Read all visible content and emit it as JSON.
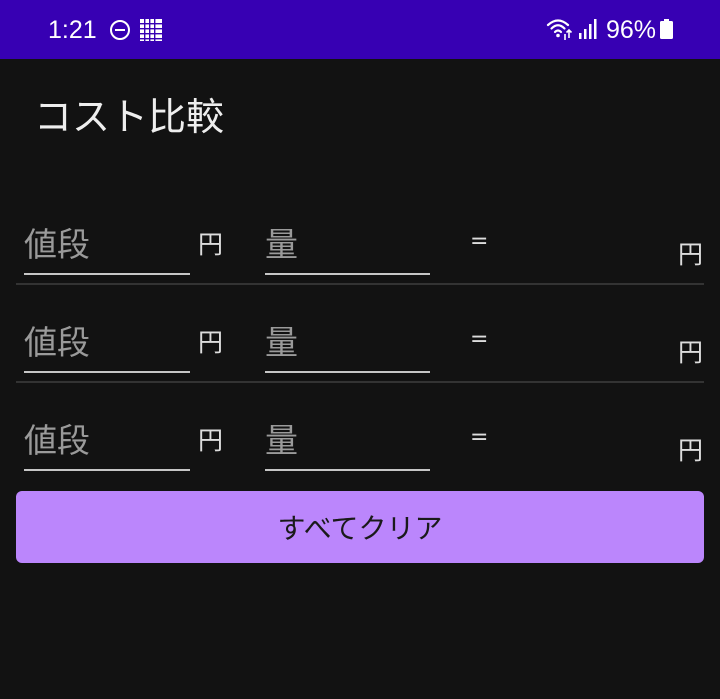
{
  "status_bar": {
    "time": "1:21",
    "battery": "96%",
    "background": "#3700b3"
  },
  "app": {
    "title": "コスト比較",
    "background": "#121212"
  },
  "rows": [
    {
      "price_placeholder": "値段",
      "price_value": "",
      "price_unit": "円",
      "qty_placeholder": "量",
      "qty_value": "",
      "equals": "=",
      "result_unit": "円"
    },
    {
      "price_placeholder": "値段",
      "price_value": "",
      "price_unit": "円",
      "qty_placeholder": "量",
      "qty_value": "",
      "equals": "=",
      "result_unit": "円"
    },
    {
      "price_placeholder": "値段",
      "price_value": "",
      "price_unit": "円",
      "qty_placeholder": "量",
      "qty_value": "",
      "equals": "=",
      "result_unit": "円"
    }
  ],
  "clear_button": {
    "label": "すべてクリア",
    "color": "#bb86fc"
  },
  "icons": [
    "do-not-disturb-icon",
    "grid-icon",
    "wifi-icon",
    "signal-icon",
    "battery-icon"
  ]
}
